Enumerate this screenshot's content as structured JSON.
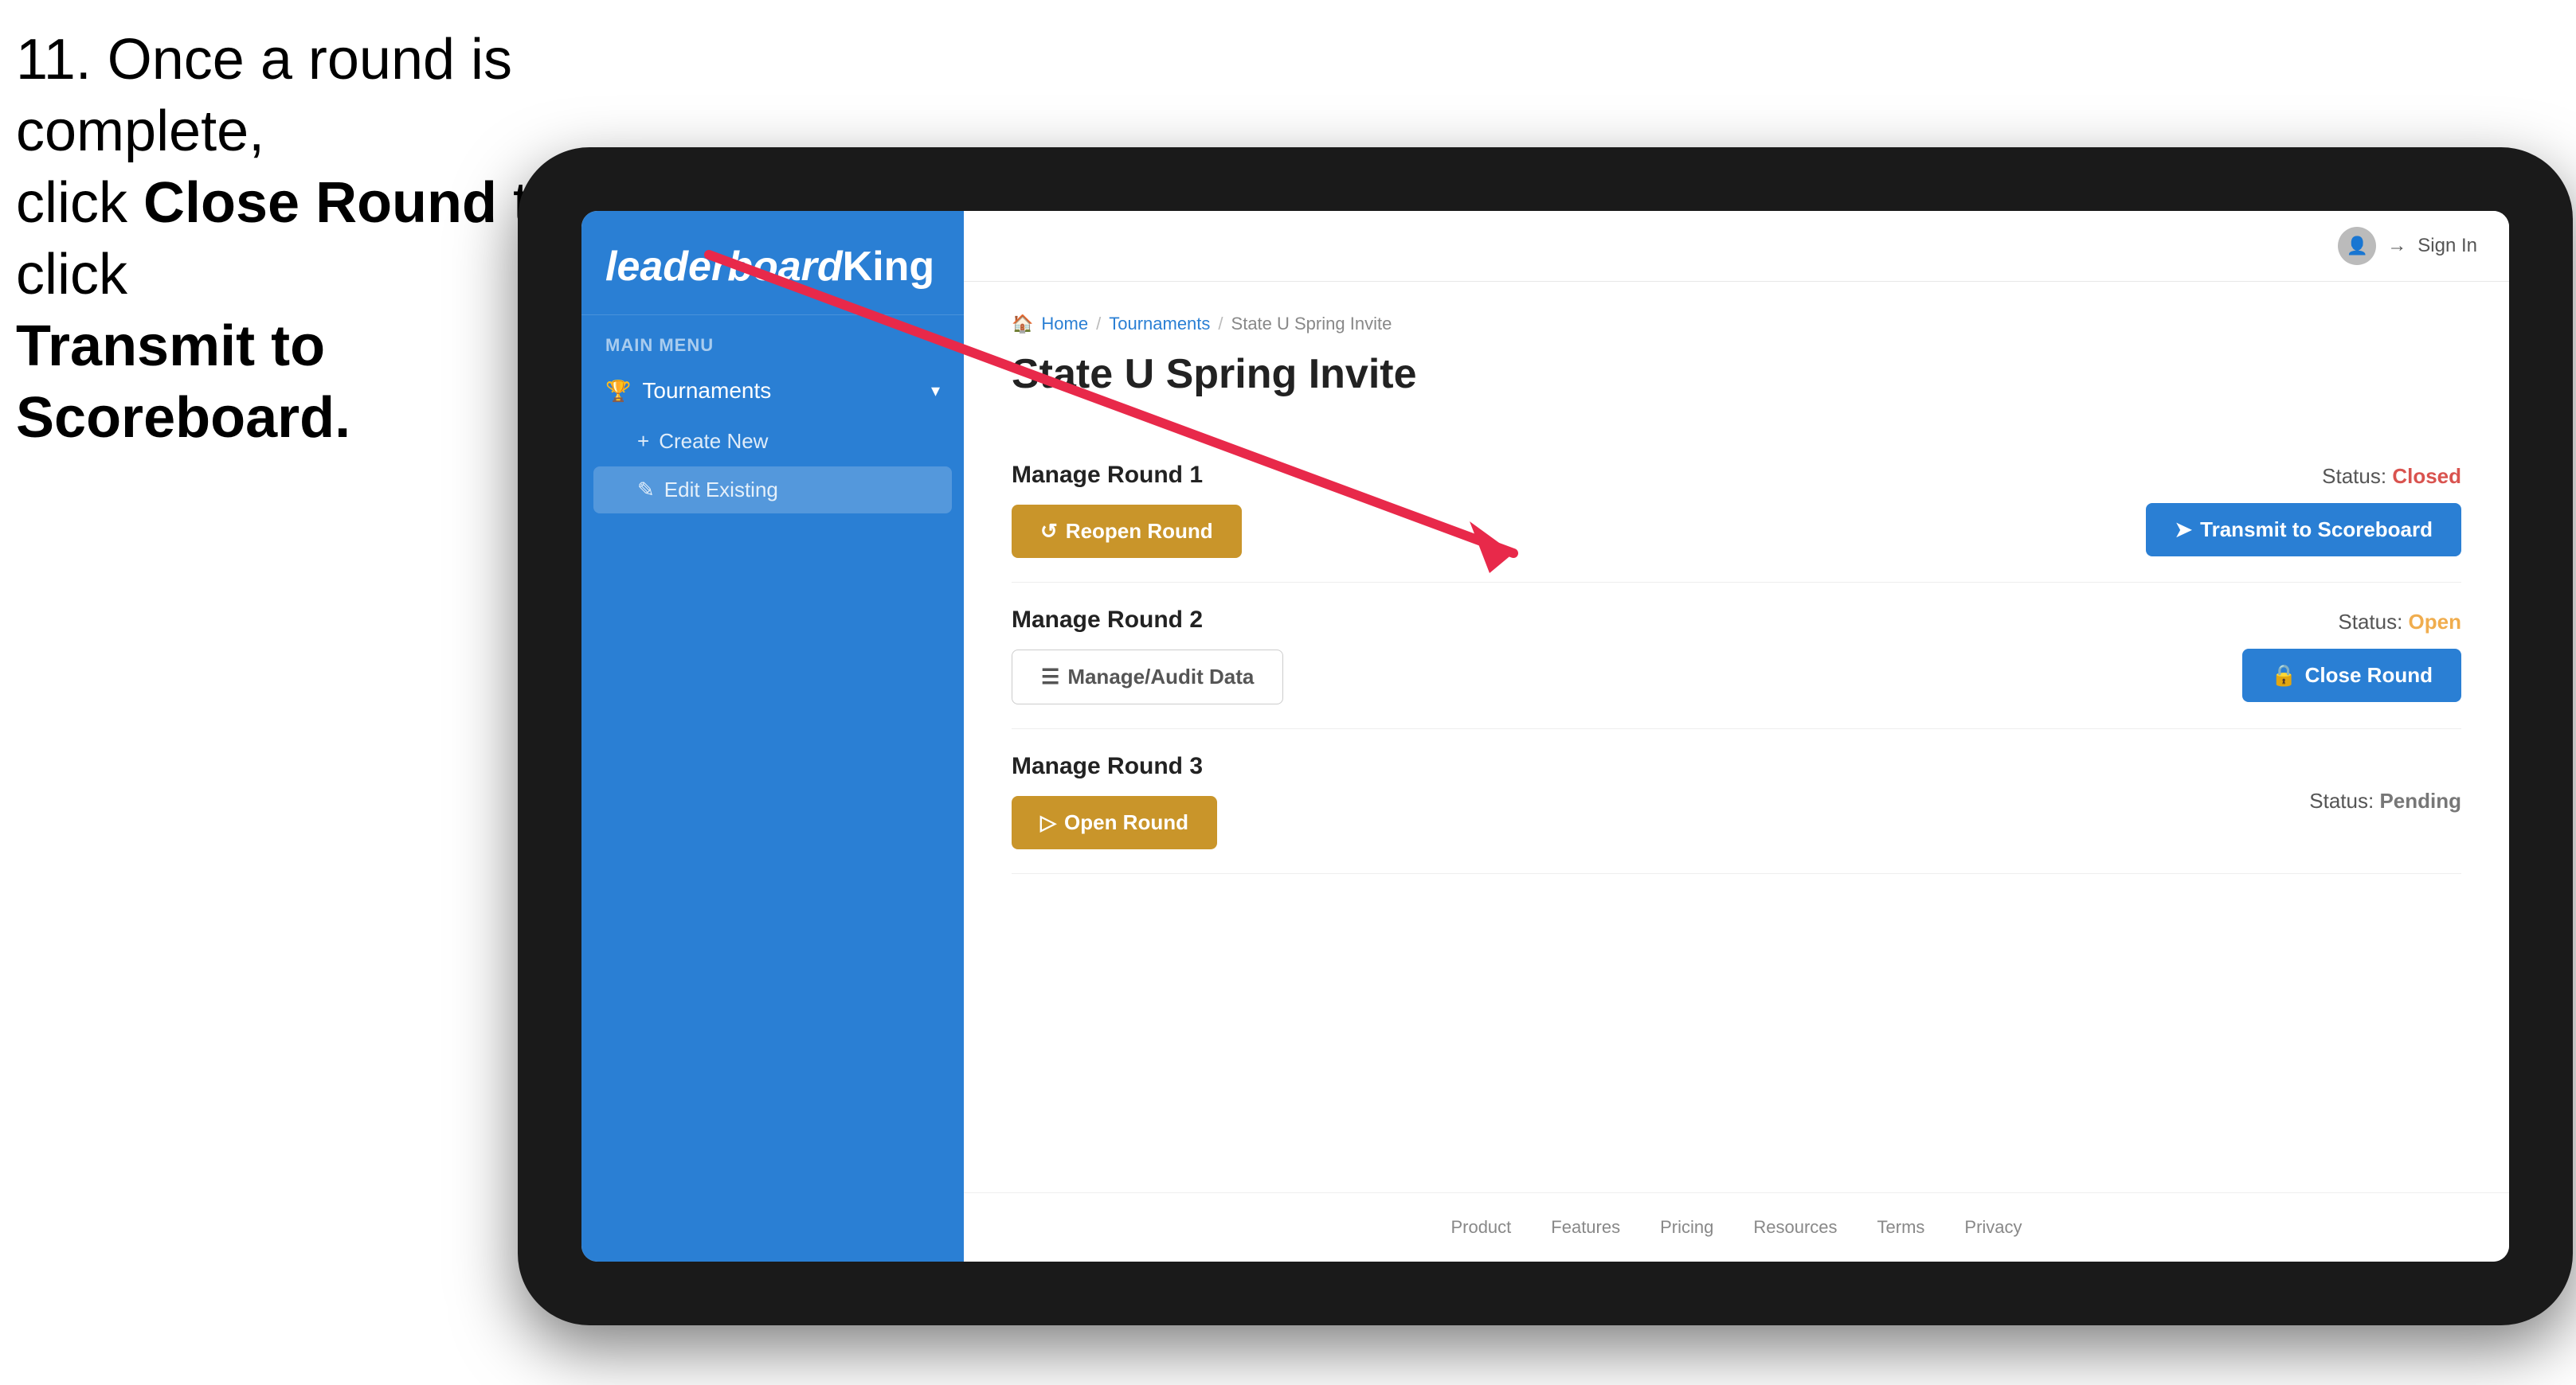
{
  "instruction": {
    "line1": "11. Once a round is complete,",
    "line2_prefix": "click ",
    "line2_bold": "Close Round",
    "line2_suffix": " then click",
    "line3_bold": "Transmit to Scoreboard."
  },
  "sidebar": {
    "logo": "leaderboard",
    "logo_bold": "King",
    "main_menu_label": "MAIN MENU",
    "nav_items": [
      {
        "id": "tournaments",
        "label": "Tournaments",
        "icon": "🏆",
        "expanded": true
      }
    ],
    "sub_items": [
      {
        "id": "create-new",
        "label": "Create New",
        "icon": "+",
        "active": false
      },
      {
        "id": "edit-existing",
        "label": "Edit Existing",
        "icon": "✎",
        "active": true
      }
    ]
  },
  "topbar": {
    "sign_in_label": "Sign In"
  },
  "breadcrumb": {
    "home": "Home",
    "tournaments": "Tournaments",
    "current": "State U Spring Invite"
  },
  "page": {
    "title": "State U Spring Invite"
  },
  "rounds": [
    {
      "id": "round-1",
      "title": "Manage Round 1",
      "status_label": "Status:",
      "status_value": "Closed",
      "status_class": "status-closed",
      "buttons": [
        {
          "id": "reopen-round",
          "label": "Reopen Round",
          "style": "btn-gold",
          "icon": "↺"
        },
        {
          "id": "transmit-scoreboard",
          "label": "Transmit to Scoreboard",
          "style": "btn-blue",
          "icon": "➤"
        }
      ]
    },
    {
      "id": "round-2",
      "title": "Manage Round 2",
      "status_label": "Status:",
      "status_value": "Open",
      "status_class": "status-open",
      "buttons": [
        {
          "id": "manage-audit",
          "label": "Manage/Audit Data",
          "style": "btn-outline-gray",
          "icon": "☰"
        },
        {
          "id": "close-round",
          "label": "Close Round",
          "style": "btn-blue",
          "icon": "🔒"
        }
      ]
    },
    {
      "id": "round-3",
      "title": "Manage Round 3",
      "status_label": "Status:",
      "status_value": "Pending",
      "status_class": "status-pending",
      "buttons": [
        {
          "id": "open-round",
          "label": "Open Round",
          "style": "btn-gold",
          "icon": "▷"
        }
      ]
    }
  ],
  "footer": {
    "links": [
      "Product",
      "Features",
      "Pricing",
      "Resources",
      "Terms",
      "Privacy"
    ]
  }
}
